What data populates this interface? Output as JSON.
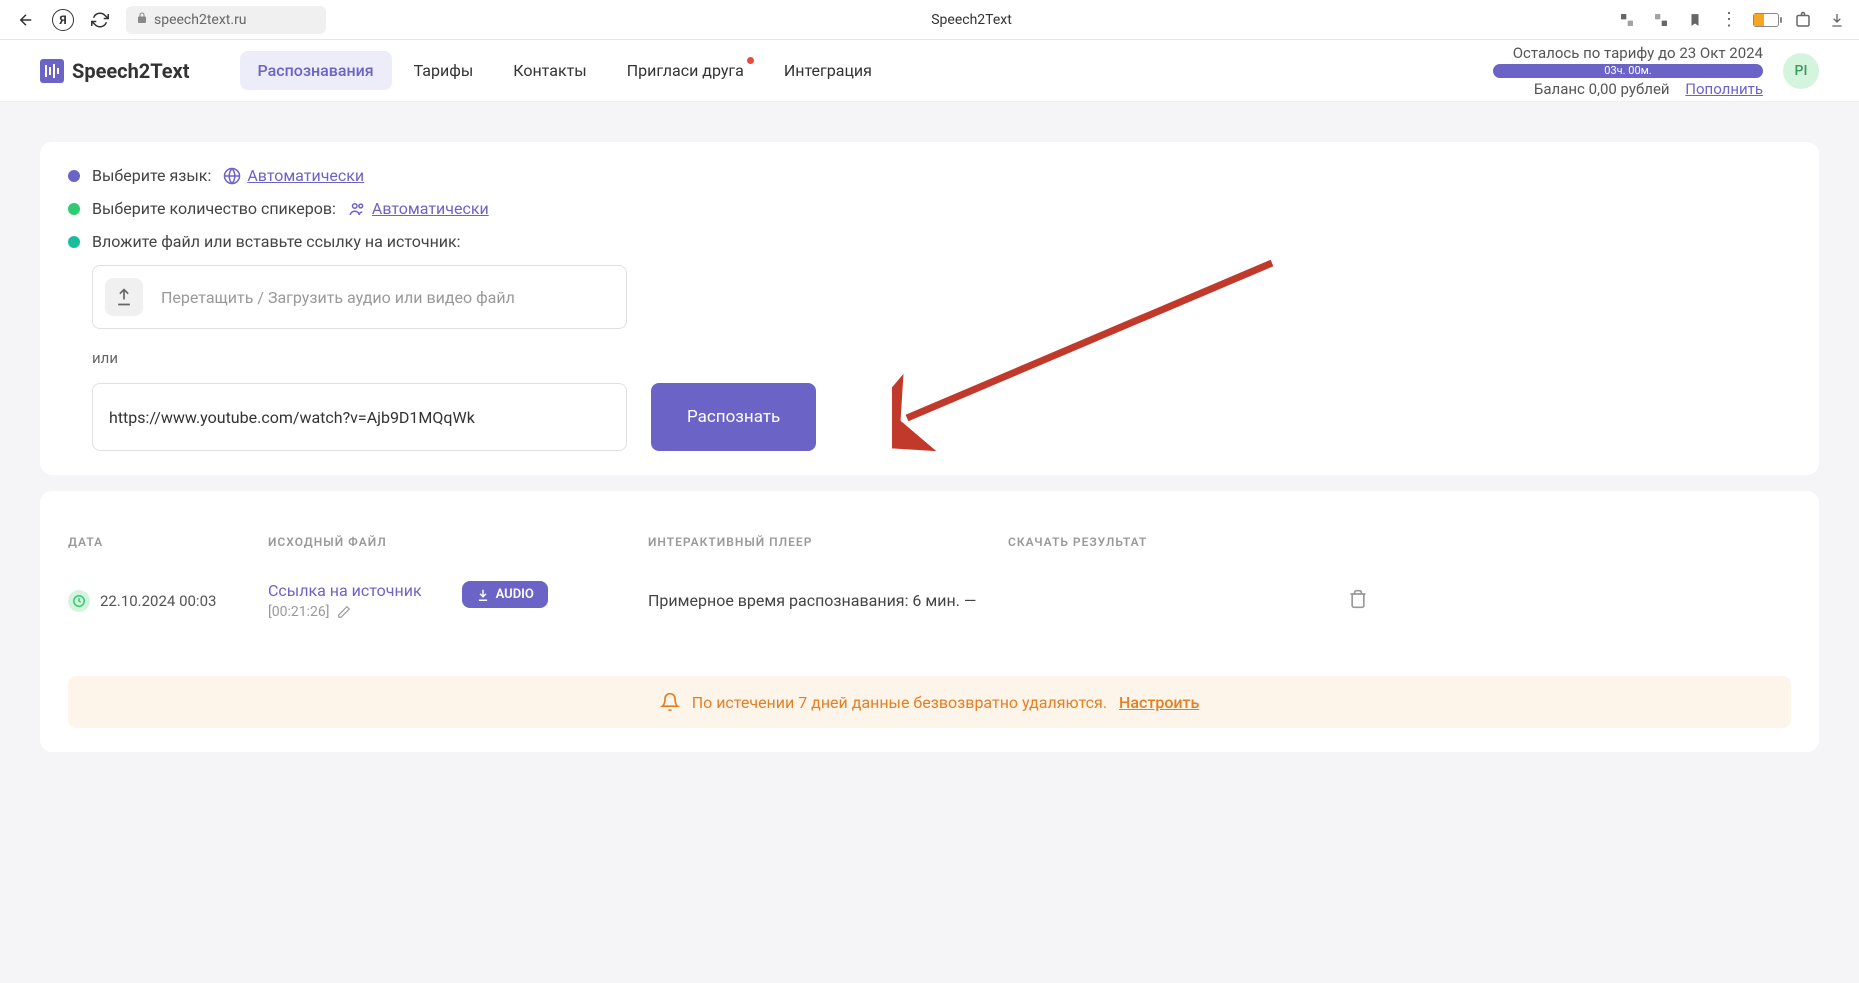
{
  "browser": {
    "url": "speech2text.ru",
    "pageTitle": "Speech2Text"
  },
  "header": {
    "logo": "Speech2Text",
    "nav": {
      "recognitions": "Распознавания",
      "tariffs": "Тарифы",
      "contacts": "Контакты",
      "invite": "Пригласи друга",
      "integration": "Интеграция"
    },
    "tariff": {
      "remaining": "Осталось по тарифу до 23 Окт 2024",
      "time": "03ч. 00м.",
      "balance": "Баланс 0,00 рублей",
      "topup": "Пополнить"
    },
    "avatar": "PI"
  },
  "upload": {
    "step1Label": "Выберите язык:",
    "step1Value": "Автоматически",
    "step2Label": "Выберите количество спикеров:",
    "step2Value": "Автоматически",
    "step3Label": "Вложите файл или вставьте ссылку на источник:",
    "dropzone": "Перетащить / Загрузить аудио или видео файл",
    "or": "или",
    "urlValue": "https://www.youtube.com/watch?v=Ajb9D1MQqWk",
    "recognizeBtn": "Распознать"
  },
  "table": {
    "headers": {
      "date": "ДАТА",
      "source": "ИСХОДНЫЙ ФАЙЛ",
      "player": "ИНТЕРАКТИВНЫЙ ПЛЕЕР",
      "download": "СКАЧАТЬ РЕЗУЛЬТАТ"
    },
    "row": {
      "date": "22.10.2024 00:03",
      "sourceLink": "Ссылка на источник",
      "duration": "[00:21:26]",
      "audioBtn": "AUDIO",
      "playerText": "Примерное время распознавания: 6 мин. —"
    }
  },
  "notice": {
    "text": "По истечении 7 дней данные безвозвратно удаляются.",
    "link": "Настроить"
  }
}
